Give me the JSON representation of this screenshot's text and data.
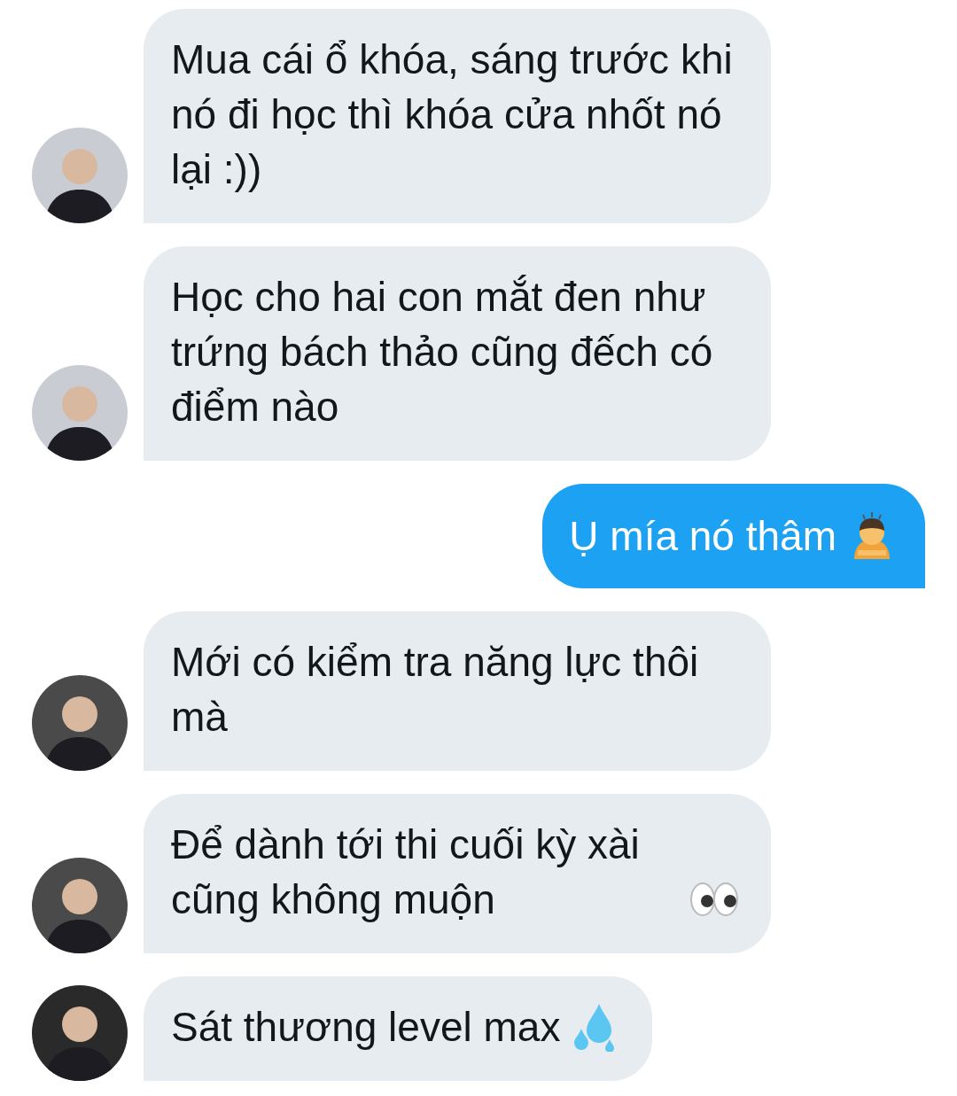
{
  "messages": [
    {
      "kind": "received",
      "text": "Mua cái ổ khóa, sáng trước khi nó đi học thì khóa cửa nhốt nó lại :))",
      "color": "#c9ccd3"
    },
    {
      "kind": "received",
      "text": "Học cho hai con mắt đen như trứng bách thảo cũng đếch có điểm nào",
      "color": "#c9ccd3"
    },
    {
      "kind": "sent",
      "text": "Ụ mía nó thâm"
    },
    {
      "kind": "received",
      "text": "Mới có kiểm tra năng lực thôi mà",
      "color": "#4a4a4a"
    },
    {
      "kind": "received",
      "text": "Để dành tới thi cuối kỳ xài cũng không muộn",
      "color": "#4a4a4a"
    },
    {
      "kind": "received",
      "text": "Sát thương level max",
      "color": "#2a2a2a"
    }
  ]
}
